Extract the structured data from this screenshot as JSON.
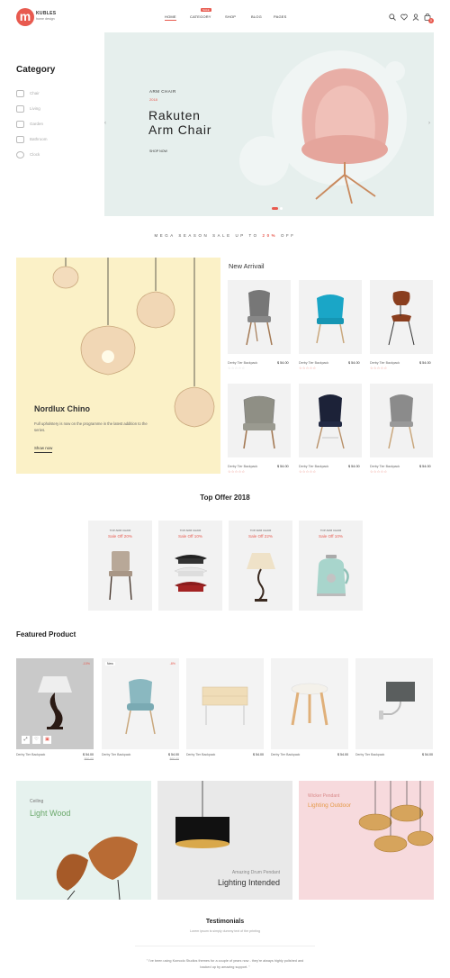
{
  "brand": {
    "name": "KUBLES",
    "tagline": "home design",
    "logo_letter": "m"
  },
  "nav": {
    "items": [
      "HOME",
      "CATEGORY",
      "SHOP",
      "BLOG",
      "PAGES"
    ],
    "badge": "SALE",
    "cart_count": "0"
  },
  "sidebar": {
    "title": "Category",
    "items": [
      "Chair",
      "Living",
      "Garden",
      "Bathroom",
      "Clock"
    ]
  },
  "hero": {
    "eyebrow": "ARM CHAIR",
    "year": "2018",
    "title_line1": "Rakuten",
    "title_line2": "Arm Chair",
    "cta": "SHOP NOW"
  },
  "promo": {
    "text": "MEGA SEASON SALE UP TO",
    "highlight": "20%",
    "suffix": "OFF"
  },
  "feature_banner": {
    "title": "Nordlux Chino",
    "desc": "Full upholstery is now on the programme in the latest addition to the series.",
    "cta": "Show now"
  },
  "new_arrival": {
    "title": "New Arrivail",
    "products": [
      {
        "name": "Derby Tier Backpack",
        "price": "$ 54.00"
      },
      {
        "name": "Derby Tier Backpack",
        "price": "$ 54.00"
      },
      {
        "name": "Derby Tier Backpack",
        "price": "$ 54.00"
      },
      {
        "name": "Derby Tier Backpack",
        "price": "$ 54.00"
      },
      {
        "name": "Derby Tier Backpack",
        "price": "$ 54.00"
      },
      {
        "name": "Derby Tier Backpack",
        "price": "$ 54.00"
      }
    ]
  },
  "top_offer": {
    "title": "Top Offer 2018",
    "items": [
      {
        "kicker": "TOP ARM CHAIR",
        "sale": "Sale Off 20%"
      },
      {
        "kicker": "TOP ARM CHAIR",
        "sale": "Sale Off 10%"
      },
      {
        "kicker": "TOP ARM CHAIR",
        "sale": "Sale Off 22%"
      },
      {
        "kicker": "TOP ARM CHAIR",
        "sale": "Sale Off 10%"
      }
    ]
  },
  "featured": {
    "title": "Featured Product",
    "products": [
      {
        "name": "Derby Tier Backpack",
        "price": "$ 54.00",
        "old": "$60.00",
        "badge": "-10%"
      },
      {
        "name": "Derby Tier Backpack",
        "price": "$ 54.00",
        "old": "$60.00",
        "badge": "-8%",
        "tag": "New"
      },
      {
        "name": "Derby Tier Backpack",
        "price": "$ 54.00"
      },
      {
        "name": "Derby Tier Backpack",
        "price": "$ 54.00"
      },
      {
        "name": "Derby Tier Backpack",
        "price": "$ 54.00"
      }
    ]
  },
  "banners": [
    {
      "kicker": "Ceiling",
      "title": "Light Wood"
    },
    {
      "kicker": "Amazing Drum Pendant",
      "title": "Lighting Intended"
    },
    {
      "kicker": "Wicker Pendant",
      "title": "Lighting Outdoor"
    }
  ],
  "testimonials": {
    "title": "Testimonials",
    "subtitle": "Lorem ipsum is simply dummy text of the printing",
    "quote": "\" I've been using Komodo Studios themes for a couple of years now - they're always highly polished and backed up by amazing support. \""
  },
  "colors": {
    "accent": "#e85a4f",
    "hero_bg": "#e6efed",
    "banner_yellow": "#fbf1c7",
    "banner_mint": "#e6f2ee",
    "banner_pink": "#f7dadd"
  }
}
